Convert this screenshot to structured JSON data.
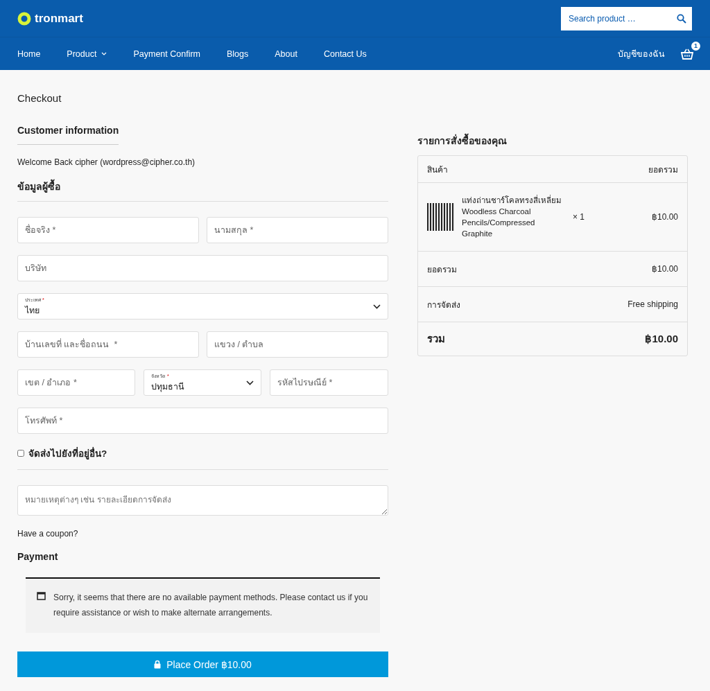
{
  "header": {
    "logo": "tronmart",
    "search": {
      "placeholder": "Search product …"
    }
  },
  "nav": {
    "items": [
      {
        "label": "Home",
        "dropdown": false
      },
      {
        "label": "Product",
        "dropdown": true
      },
      {
        "label": "Payment Confirm",
        "dropdown": false
      },
      {
        "label": "Blogs",
        "dropdown": false
      },
      {
        "label": "About",
        "dropdown": false
      },
      {
        "label": "Contact Us",
        "dropdown": false
      }
    ],
    "account": "บัญชีของฉัน",
    "cart_count": "1"
  },
  "page_title": "Checkout",
  "customer": {
    "heading": "Customer information",
    "welcome": "Welcome Back cipher (wordpress@cipher.co.th)"
  },
  "billing": {
    "heading": "ข้อมูลผู้ซื้อ",
    "rows": [
      [
        {
          "kind": "text",
          "placeholder": "ชื่อจริง *"
        },
        {
          "kind": "text",
          "placeholder": "นามสกุล *"
        }
      ],
      [
        {
          "kind": "text",
          "placeholder": "บริษัท"
        }
      ],
      [
        {
          "kind": "select",
          "label": "ประเทศ",
          "required_mark": "*",
          "value": "ไทย"
        }
      ],
      [
        {
          "kind": "text",
          "placeholder": "บ้านเลขที่ และชื่อถนน  *"
        },
        {
          "kind": "text",
          "placeholder": "แขวง / ตำบล"
        }
      ],
      [
        {
          "kind": "text",
          "placeholder": "เขต / อำเภอ *"
        },
        {
          "kind": "select",
          "label": "จังหวัด",
          "required_mark": "*",
          "value": "ปทุมธานี"
        },
        {
          "kind": "text",
          "placeholder": "รหัสไปรษณีย์ *"
        }
      ],
      [
        {
          "kind": "text",
          "placeholder": "โทรศัพท์ *"
        }
      ]
    ]
  },
  "ship_elsewhere": {
    "label": "จัดส่งไปยังที่อยู่อื่น?",
    "checked": false
  },
  "notes": {
    "placeholder": "หมายเหตุต่างๆ เช่น รายละเอียดการจัดส่ง"
  },
  "coupon": "Have a coupon?",
  "payment": {
    "heading": "Payment",
    "notice": "Sorry, it seems that there are no available payment methods. Please contact us if you require assistance or wish to make alternate arrangements."
  },
  "place_order": "Place Order ฿10.00",
  "order": {
    "heading": "รายการสั่งซื้อของคุณ",
    "columns": [
      "สินค้า",
      "ยอดรวม"
    ],
    "items": [
      {
        "name": "แท่งถ่านชาร์โคลทรงสี่เหลี่ยม Woodless Charcoal Pencils/Compressed Graphite",
        "qty": "× 1",
        "total": "฿10.00"
      }
    ],
    "summary": [
      {
        "label": "ยอดรวม",
        "value": "฿10.00",
        "kind": "subtotal"
      },
      {
        "label": "การจัดส่ง",
        "value": "Free shipping",
        "kind": "shipping"
      },
      {
        "label": "รวม",
        "value": "฿10.00",
        "kind": "total"
      }
    ]
  }
}
